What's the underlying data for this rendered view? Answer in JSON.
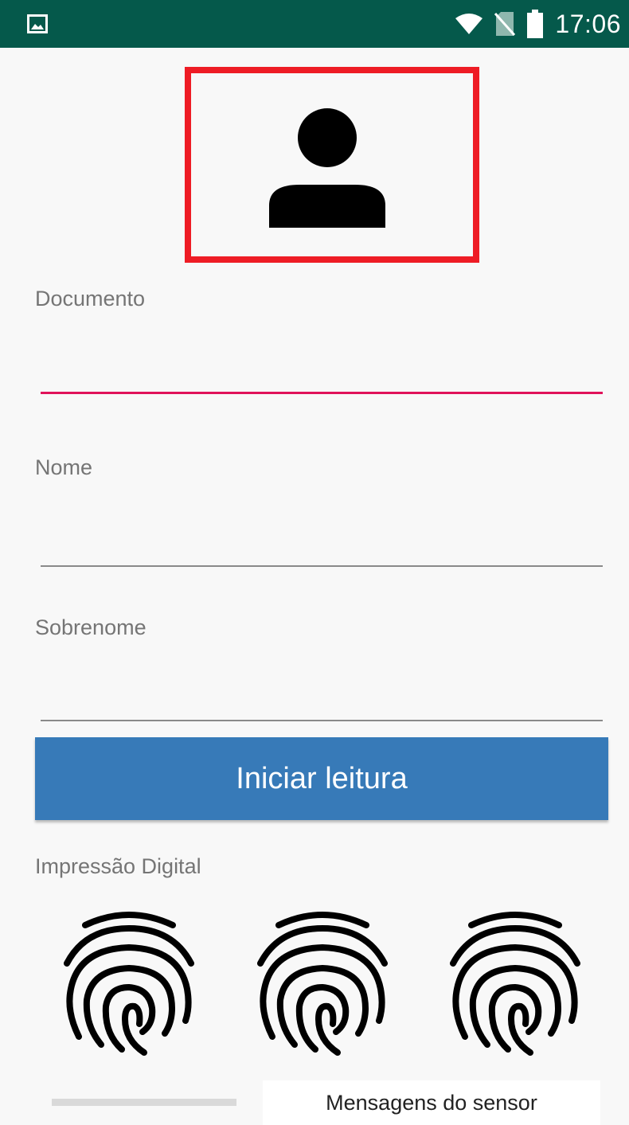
{
  "status_bar": {
    "time": "17:06",
    "background_color": "#05594b",
    "icons": [
      "image-icon",
      "wifi-icon",
      "no-sim-icon",
      "battery-icon"
    ]
  },
  "photo": {
    "icon": "person-icon",
    "border_color": "#ee1c25"
  },
  "form": {
    "documento": {
      "label": "Documento",
      "value": "",
      "active": true
    },
    "nome": {
      "label": "Nome",
      "value": ""
    },
    "sobrenome": {
      "label": "Sobrenome",
      "value": ""
    },
    "active_underline_color": "#e0125a"
  },
  "start_button": {
    "label": "Iniciar leitura",
    "color": "#377ab8"
  },
  "fingerprint_section": {
    "label": "Impressão Digital",
    "fingerprints": [
      {
        "icon": "fingerprint-icon"
      },
      {
        "icon": "fingerprint-icon"
      },
      {
        "icon": "fingerprint-icon"
      }
    ]
  },
  "sensor": {
    "messages_label": "Mensagens do sensor"
  }
}
